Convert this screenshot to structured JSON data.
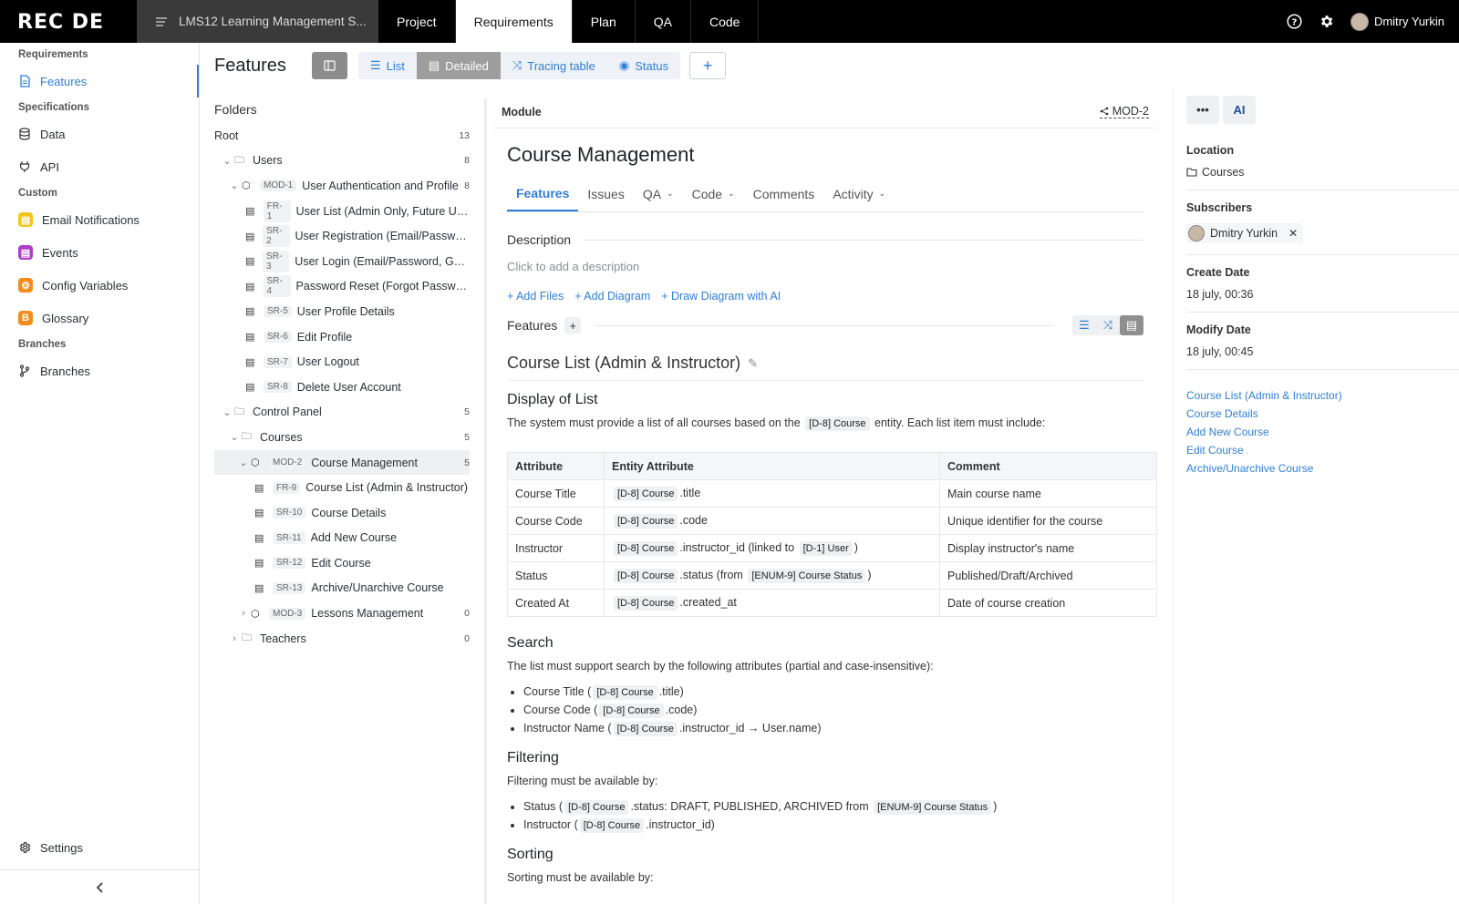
{
  "app": {
    "logo": "REC DE",
    "project": "LMS12 Learning Management S..."
  },
  "topnav": [
    "Project",
    "Requirements",
    "Plan",
    "QA",
    "Code"
  ],
  "topnav_active": "Requirements",
  "user": {
    "name": "Dmitry Yurkin"
  },
  "sidebar": {
    "sections": {
      "requirements": "Requirements",
      "specifications": "Specifications",
      "custom": "Custom",
      "branches": "Branches"
    },
    "features": "Features",
    "data": "Data",
    "api": "API",
    "email": "Email Notifications",
    "events": "Events",
    "config": "Config Variables",
    "glossary": "Glossary",
    "branches_item": "Branches",
    "settings": "Settings"
  },
  "colors": {
    "accent": "#2f7fd8",
    "email": "#f5c518",
    "events": "#b03ec9",
    "config": "#f28c1b",
    "glossary": "#f28c1b"
  },
  "header": {
    "title": "Features",
    "views": [
      "List",
      "Detailed",
      "Tracing table",
      "Status"
    ],
    "active_view": "Detailed",
    "add": "+"
  },
  "tree": {
    "title": "Folders",
    "root": {
      "label": "Root",
      "count": "13"
    },
    "rows": [
      {
        "type": "folder",
        "label": "Users",
        "count": "8"
      },
      {
        "type": "module",
        "code": "MOD-1",
        "label": "User Authentication and Profile",
        "count": "8"
      },
      {
        "type": "doc",
        "code": "FR-1",
        "label": "User List (Admin Only, Future Use)"
      },
      {
        "type": "doc",
        "code": "SR-2",
        "label": "User Registration (Email/Password..."
      },
      {
        "type": "doc",
        "code": "SR-3",
        "label": "User Login (Email/Password, Goog..."
      },
      {
        "type": "doc",
        "code": "SR-4",
        "label": "Password Reset (Forgot Password)"
      },
      {
        "type": "doc",
        "code": "SR-5",
        "label": "User Profile Details"
      },
      {
        "type": "doc",
        "code": "SR-6",
        "label": "Edit Profile"
      },
      {
        "type": "doc",
        "code": "SR-7",
        "label": "User Logout"
      },
      {
        "type": "doc",
        "code": "SR-8",
        "label": "Delete User Account"
      },
      {
        "type": "folder",
        "label": "Control Panel",
        "count": "5"
      },
      {
        "type": "folder",
        "label": "Courses",
        "count": "5"
      },
      {
        "type": "module",
        "code": "MOD-2",
        "label": "Course Management",
        "count": "5"
      },
      {
        "type": "doc",
        "code": "FR-9",
        "label": "Course List (Admin & Instructor)"
      },
      {
        "type": "doc",
        "code": "SR-10",
        "label": "Course Details"
      },
      {
        "type": "doc",
        "code": "SR-11",
        "label": "Add New Course"
      },
      {
        "type": "doc",
        "code": "SR-12",
        "label": "Edit Course"
      },
      {
        "type": "doc",
        "code": "SR-13",
        "label": "Archive/Unarchive Course"
      },
      {
        "type": "module",
        "code": "MOD-3",
        "label": "Lessons Management",
        "count": "0"
      },
      {
        "type": "folder",
        "label": "Teachers",
        "count": "0"
      }
    ]
  },
  "main": {
    "module_label": "Module",
    "module_code": "MOD-2",
    "title": "Course Management",
    "tabs": [
      "Features",
      "Issues",
      "QA",
      "Code",
      "Comments",
      "Activity"
    ],
    "description_label": "Description",
    "description_placeholder": "Click to add a description",
    "actions": [
      "+ Add Files",
      "+ Add Diagram",
      "+ Draw Diagram with AI"
    ],
    "features_label": "Features",
    "feature_title": "Course List (Admin & Instructor)",
    "display_h": "Display of List",
    "display_p1": "The system must provide a list of all courses based on the",
    "display_ref": "[D-8] Course",
    "display_p2": "entity. Each list item must include:",
    "table": {
      "headers": [
        "Attribute",
        "Entity Attribute",
        "Comment"
      ],
      "rows": [
        {
          "attr": "Course Title",
          "ref": "[D-8] Course",
          "rest": ".title",
          "comment": "Main course name"
        },
        {
          "attr": "Course Code",
          "ref": "[D-8] Course",
          "rest": ".code",
          "comment": "Unique identifier for the course"
        },
        {
          "attr": "Instructor",
          "ref": "[D-8] Course",
          "rest": ".instructor_id (linked to",
          "ref2": "[D-1] User",
          "end": ")",
          "comment": "Display instructor's name"
        },
        {
          "attr": "Status",
          "ref": "[D-8] Course",
          "rest": ".status (from",
          "ref2": "[ENUM-9] Course Status",
          "end": ")",
          "comment": "Published/Draft/Archived"
        },
        {
          "attr": "Created At",
          "ref": "[D-8] Course",
          "rest": ".created_at",
          "comment": "Date of course creation"
        }
      ]
    },
    "search_h": "Search",
    "search_p": "The list must support search by the following attributes (partial and case-insensitive):",
    "search_items": [
      {
        "pre": "Course Title (",
        "ref": "[D-8] Course",
        "post": ".title)"
      },
      {
        "pre": "Course Code (",
        "ref": "[D-8] Course",
        "post": ".code)"
      },
      {
        "pre": "Instructor Name (",
        "ref": "[D-8] Course",
        "post": ".instructor_id → User.name)"
      }
    ],
    "filter_h": "Filtering",
    "filter_p": "Filtering must be available by:",
    "filter_items": [
      {
        "pre": "Status (",
        "ref": "[D-8] Course",
        "post": ".status: DRAFT, PUBLISHED, ARCHIVED from",
        "ref2": "[ENUM-9] Course Status",
        "end": ")"
      },
      {
        "pre": "Instructor (",
        "ref": "[D-8] Course",
        "post": ".instructor_id)"
      }
    ],
    "sort_h": "Sorting",
    "sort_p": "Sorting must be available by:"
  },
  "right": {
    "more": "•••",
    "ai": "AI",
    "location_label": "Location",
    "location": "Courses",
    "subscribers_label": "Subscribers",
    "subscriber": "Dmitry Yurkin",
    "create_label": "Create Date",
    "create": "18 july, 00:36",
    "modify_label": "Modify Date",
    "modify": "18 july, 00:45",
    "links": [
      "Course List (Admin & Instructor)",
      "Course Details",
      "Add New Course",
      "Edit Course",
      "Archive/Unarchive Course"
    ]
  }
}
